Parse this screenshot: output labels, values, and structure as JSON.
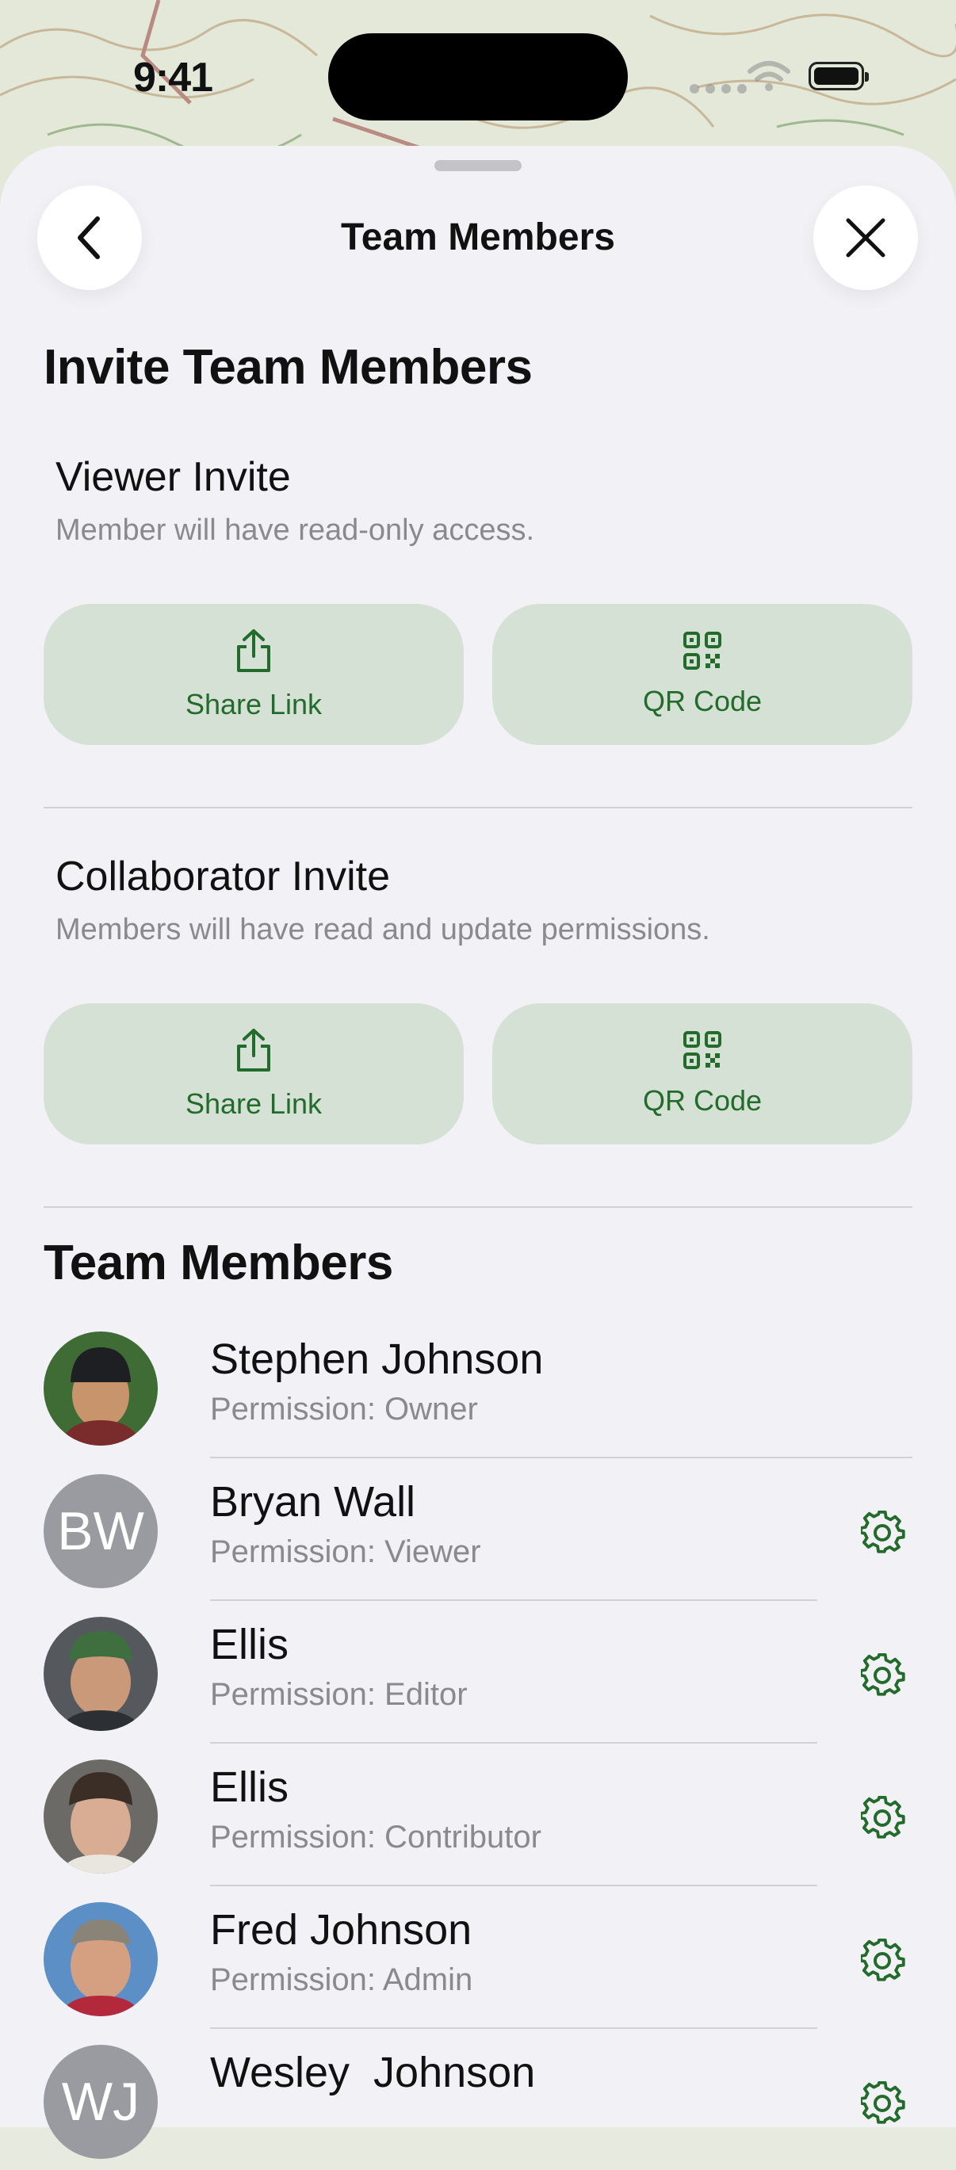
{
  "status_bar": {
    "time": "9:41"
  },
  "nav": {
    "title": "Team Members"
  },
  "invite_section": {
    "heading": "Invite Team Members",
    "invites": [
      {
        "title": "Viewer Invite",
        "subtitle": "Member will have read-only access.",
        "share_label": "Share Link",
        "qr_label": "QR Code"
      },
      {
        "title": "Collaborator Invite",
        "subtitle": "Members will have read and update permissions.",
        "share_label": "Share Link",
        "qr_label": "QR Code"
      }
    ]
  },
  "members_section": {
    "heading": "Team Members",
    "members": [
      {
        "name": "Stephen Johnson",
        "permission": "Permission: Owner",
        "avatar": "photo",
        "avatar_colors": [
          "#2f4a2a",
          "#c8946c"
        ]
      },
      {
        "name": "Bryan Wall",
        "permission": "Permission: Viewer",
        "avatar": "initials",
        "initials": "BW"
      },
      {
        "name": "Ellis",
        "permission": "Permission: Editor",
        "avatar": "photo",
        "avatar_colors": [
          "#4a4f55",
          "#c9997a"
        ]
      },
      {
        "name": "Ellis",
        "permission": "Permission: Contributor",
        "avatar": "photo",
        "avatar_colors": [
          "#5d5a55",
          "#d8ad94"
        ]
      },
      {
        "name": "Fred Johnson",
        "permission": "Permission: Admin",
        "avatar": "photo",
        "avatar_colors": [
          "#4c7fb8",
          "#d5a082"
        ]
      },
      {
        "name": "Wesley  Johnson",
        "permission": "",
        "avatar": "initials",
        "initials": "WJ"
      }
    ]
  },
  "colors": {
    "accent": "#236b2b",
    "button_bg": "#d5e1d4",
    "sheet_bg": "#f2f2f6",
    "secondary_text": "#8a8a8e"
  }
}
